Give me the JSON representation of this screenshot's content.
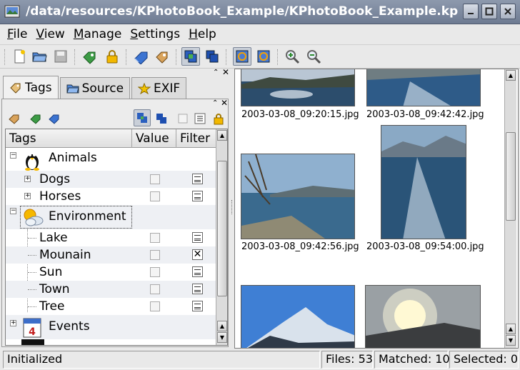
{
  "window": {
    "title": "/data/resources/KPhotoBook_Example/KPhotoBook_Example.kpb - KP",
    "controls": [
      "minimize",
      "maximize",
      "close"
    ]
  },
  "menu": [
    "File",
    "View",
    "Manage",
    "Settings",
    "Help"
  ],
  "menu_mnemonics": [
    "F",
    "V",
    "M",
    "S",
    "H"
  ],
  "toolbar": {
    "icons": [
      "new-file-icon",
      "open-folder-icon",
      "save-icon",
      "add-tag-icon",
      "lock-icon",
      "tag-blue-icon",
      "tag-edit-icon",
      "and-operator-icon",
      "or-operator-icon",
      "auto-refresh-icon",
      "refresh-icon",
      "zoom-in-icon",
      "zoom-out-icon"
    ]
  },
  "tabs": [
    {
      "label": "Tags",
      "icon": "tag-icon",
      "active": true
    },
    {
      "label": "Source",
      "icon": "folder-icon",
      "active": false
    },
    {
      "label": "EXIF",
      "icon": "star-icon",
      "active": false
    }
  ],
  "tag_table": {
    "headers": [
      "Tags",
      "Value",
      "Filter"
    ],
    "rows": [
      {
        "label": "Animals",
        "level": 0,
        "icon": "tux-penguin-icon",
        "expander": "−",
        "check": false,
        "filter": "none"
      },
      {
        "label": "Dogs",
        "level": 1,
        "expander": "+",
        "check": false,
        "filter": "lines"
      },
      {
        "label": "Horses",
        "level": 1,
        "expander": "+",
        "check": false,
        "filter": "lines"
      },
      {
        "label": "Environment",
        "level": 0,
        "icon": "weather-icon",
        "expander": "−",
        "check": false,
        "filter": "none",
        "focused": true
      },
      {
        "label": "Lake",
        "level": 1,
        "check": false,
        "filter": "lines"
      },
      {
        "label": "Mounain",
        "level": 1,
        "check": false,
        "filter": "x"
      },
      {
        "label": "Sun",
        "level": 1,
        "check": false,
        "filter": "lines"
      },
      {
        "label": "Town",
        "level": 1,
        "check": false,
        "filter": "lines"
      },
      {
        "label": "Tree",
        "level": 1,
        "check": false,
        "filter": "lines"
      },
      {
        "label": "Events",
        "level": 0,
        "icon": "calendar-icon",
        "expander": "+",
        "check": false,
        "filter": "none"
      }
    ]
  },
  "photos": [
    {
      "caption": "2003-03-08_09:20:15.jpg"
    },
    {
      "caption": "2003-03-08_09:42:42.jpg"
    },
    {
      "caption": "2003-03-08_09:42:56.jpg"
    },
    {
      "caption": "2003-03-08_09:54:00.jpg"
    },
    {
      "caption": ""
    },
    {
      "caption": ""
    }
  ],
  "status": {
    "message": "Initialized",
    "files": "Files: 53",
    "matched": "Matched: 10",
    "selected": "Selected: 0"
  },
  "colors": {
    "titlebar": "#7b879d",
    "selection_blue": "#2f64c8",
    "row_alt": "#eef0f4"
  }
}
